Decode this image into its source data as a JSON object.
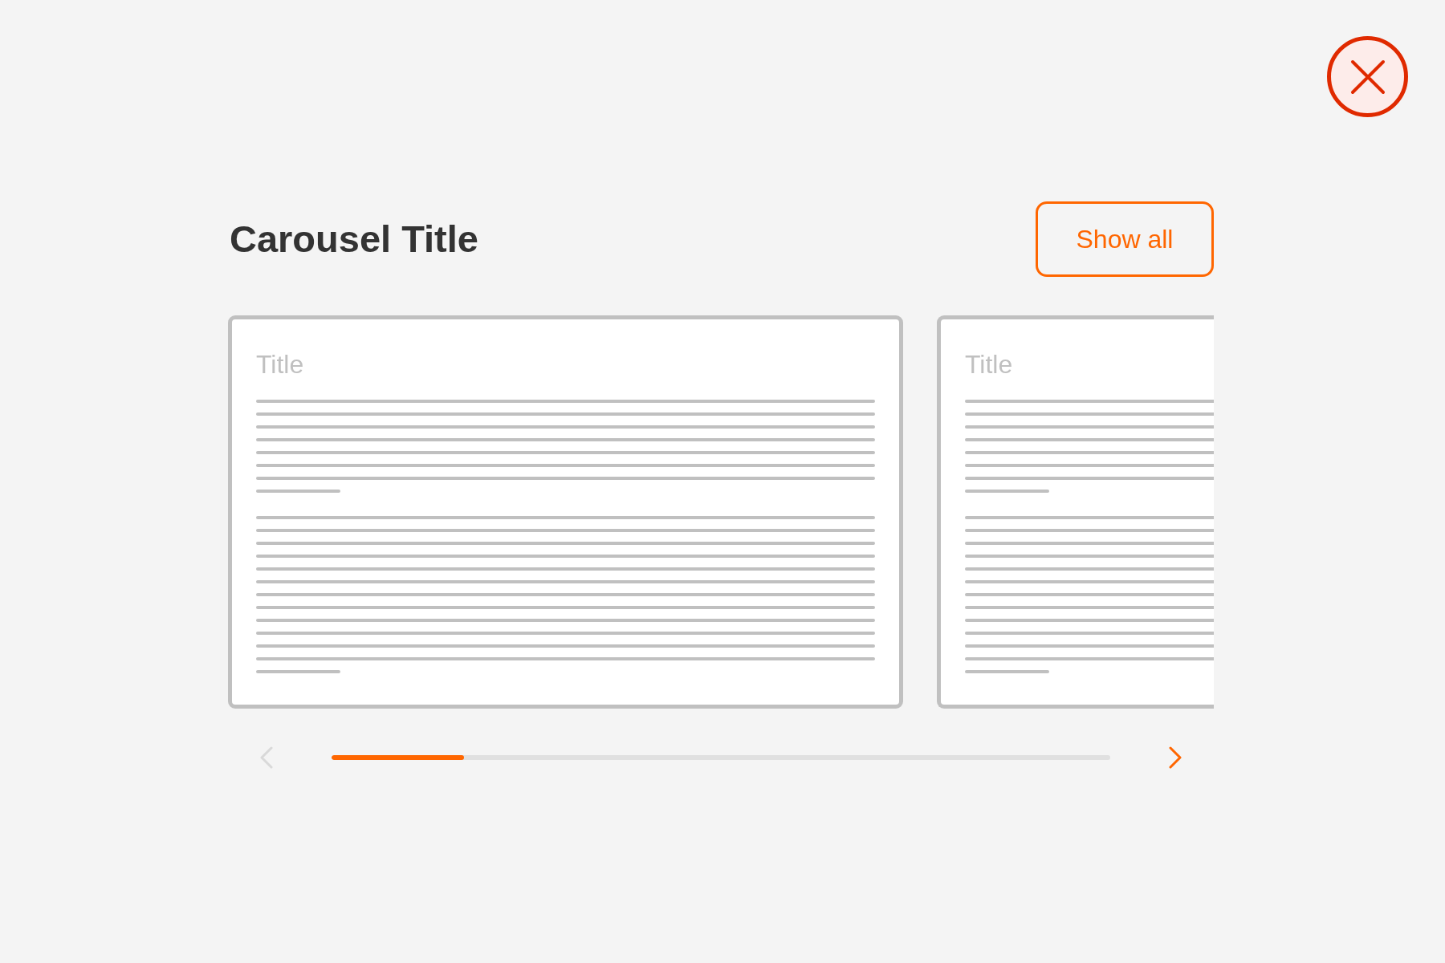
{
  "carousel": {
    "title": "Carousel Title",
    "show_all_button": "Show all",
    "cards": [
      {
        "title": "Title"
      },
      {
        "title": "Title"
      }
    ],
    "prev_button": {
      "disabled": true
    },
    "next_button": {
      "disabled": false
    },
    "scroll_progress": {
      "level": 0.17
    }
  }
}
